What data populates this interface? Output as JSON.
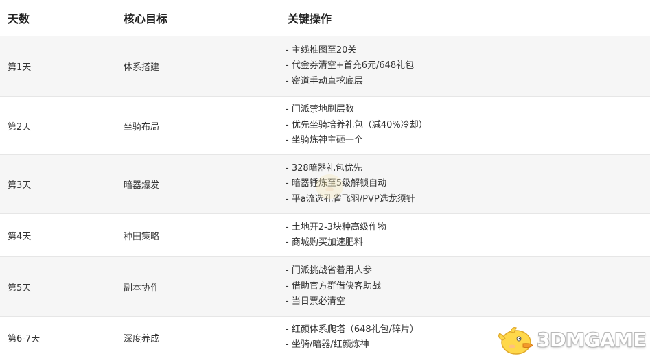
{
  "table": {
    "headers": [
      "天数",
      "核心目标",
      "关键操作"
    ],
    "rows": [
      {
        "day": "第1天",
        "goal": "体系搭建",
        "ops": [
          "- 主线推图至20关",
          "- 代金券清空+首充6元/648礼包",
          "- 密道手动直挖底层"
        ]
      },
      {
        "day": "第2天",
        "goal": "坐骑布局",
        "ops": [
          "- 门派禁地刷层数",
          "- 优先坐骑培养礼包（减40%冷却）",
          "- 坐骑炼神主砸一个"
        ]
      },
      {
        "day": "第3天",
        "goal": "暗器爆发",
        "ops": [
          "- 328暗器礼包优先",
          "- 暗器锤炼至5级解锁自动",
          "- 平a流选孔雀飞羽/PVP选龙须针"
        ]
      },
      {
        "day": "第4天",
        "goal": "种田策略",
        "ops": [
          "- 土地开2-3块种高级作物",
          "- 商城购买加速肥料"
        ]
      },
      {
        "day": "第5天",
        "goal": "副本协作",
        "ops": [
          "- 门派挑战省着用人参",
          "- 借助官方群借侠客助战",
          "- 当日票必清空"
        ]
      },
      {
        "day": "第6-7天",
        "goal": "深度养成",
        "ops": [
          "- 红颜体系爬塔（648礼包/碎片）",
          "- 坐骑/暗器/红颜炼神"
        ]
      }
    ]
  },
  "watermark": {
    "logo_text": "3DMGAME",
    "icon": "duck-mascot-icon"
  }
}
